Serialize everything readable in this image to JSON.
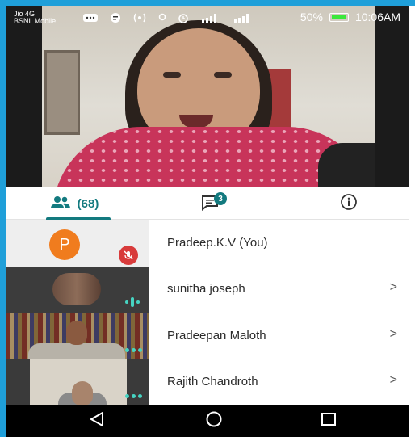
{
  "status_bar": {
    "carrier_1": "Jio 4G",
    "carrier_2": "BSNL Mobile",
    "battery": "50%",
    "time": "10:06AM"
  },
  "tabs": {
    "people_count": "(68)",
    "chat_badge": "3"
  },
  "participants": [
    {
      "name": "Pradeep.K.V (You)",
      "avatar_letter": "P",
      "muted": true,
      "has_chevron": false
    },
    {
      "name": "sunitha joseph",
      "has_chevron": true
    },
    {
      "name": "Pradeepan Maloth",
      "has_chevron": true
    },
    {
      "name": "Rajith Chandroth",
      "has_chevron": true
    }
  ],
  "chevron": ">",
  "icons": {
    "people": "people-icon",
    "chat": "chat-icon",
    "info": "info-icon",
    "mic_off": "mic-off-icon",
    "back": "nav-back-icon",
    "home": "nav-home-icon",
    "recents": "nav-recents-icon"
  },
  "colors": {
    "accent": "#137a7f",
    "avatar": "#f07c1e",
    "mic_off": "#d83b3b",
    "speaking": "#46d4c2",
    "frame_edge": "#1f9fd9"
  }
}
